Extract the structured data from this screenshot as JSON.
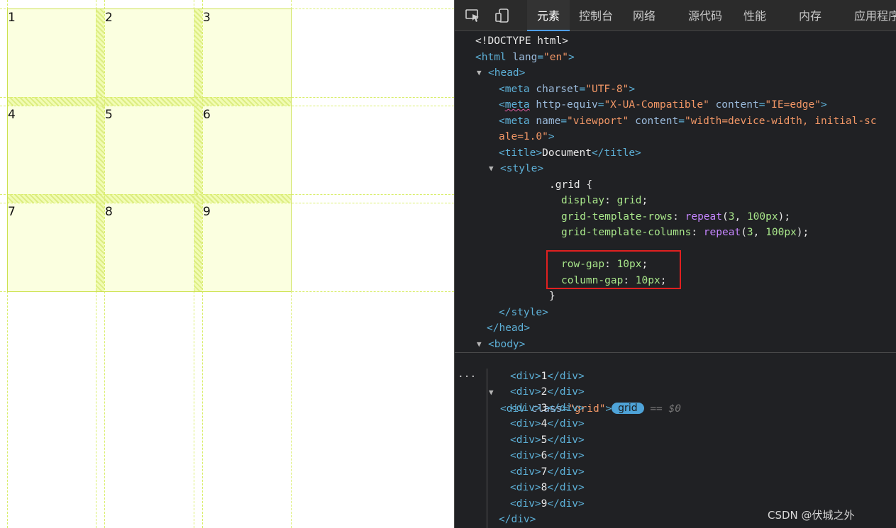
{
  "page": {
    "cells": [
      "1",
      "2",
      "3",
      "4",
      "5",
      "6",
      "7",
      "8",
      "9"
    ]
  },
  "devtools": {
    "tabs": [
      "元素",
      "控制台",
      "网络",
      "源代码",
      "性能",
      "内存",
      "应用程序"
    ],
    "active_tab": "元素",
    "code": {
      "doctype": "<!DOCTYPE html>",
      "html_open_tag": "<html",
      "html_lang_attr": "lang",
      "html_lang_val": "\"en\"",
      "head_open": "<head>",
      "meta1_tag": "<meta",
      "meta1_attr": "charset",
      "meta1_val": "\"UTF-8\"",
      "meta2_tag": "meta",
      "meta2_attr1": "http-equiv",
      "meta2_val1": "\"X-UA-Compatible\"",
      "meta2_attr2": "content",
      "meta2_val2": "\"IE=edge\"",
      "meta3_tag": "<meta",
      "meta3_attr1": "name",
      "meta3_val1": "\"viewport\"",
      "meta3_attr2": "content",
      "meta3_val2a": "\"width=device-width, initial-sc",
      "meta3_val2b": "ale=1.0\"",
      "title_open": "<title>",
      "title_text": "Document",
      "title_close": "</title>",
      "style_open": "<style>",
      "css_selector": ".grid {",
      "css_display_prop": "display",
      "css_display_val": "grid",
      "css_rows_prop": "grid-template-rows",
      "css_rows_fn": "repeat",
      "css_rows_count": "3",
      "css_rows_size": "100px",
      "css_cols_prop": "grid-template-columns",
      "css_cols_fn": "repeat",
      "css_cols_count": "3",
      "css_cols_size": "100px",
      "css_rowgap_prop": "row-gap",
      "css_rowgap_val": "10px",
      "css_colgap_prop": "column-gap",
      "css_colgap_val": "10px",
      "css_close_brace": "}",
      "style_close": "</style>",
      "head_close": "</head>",
      "body_open": "<body>",
      "div_grid_tag": "<div",
      "div_grid_attr": "class",
      "div_grid_val": "\"grid\"",
      "grid_badge": "grid",
      "eq_dollar0": "== $0",
      "children": [
        "1",
        "2",
        "3",
        "4",
        "5",
        "6",
        "7",
        "8",
        "9"
      ],
      "div_close": "</div>"
    },
    "highlight_color": "#e02020"
  },
  "watermark": "CSDN @伏城之外",
  "colors": {
    "grid_overlay": "#d9ee6a",
    "cell_fill": "#fbffe0",
    "devtools_bg": "#202124",
    "tag": "#5db0d7",
    "value": "#f29766",
    "number": "#a8e68a",
    "keyword": "#c585ff"
  }
}
